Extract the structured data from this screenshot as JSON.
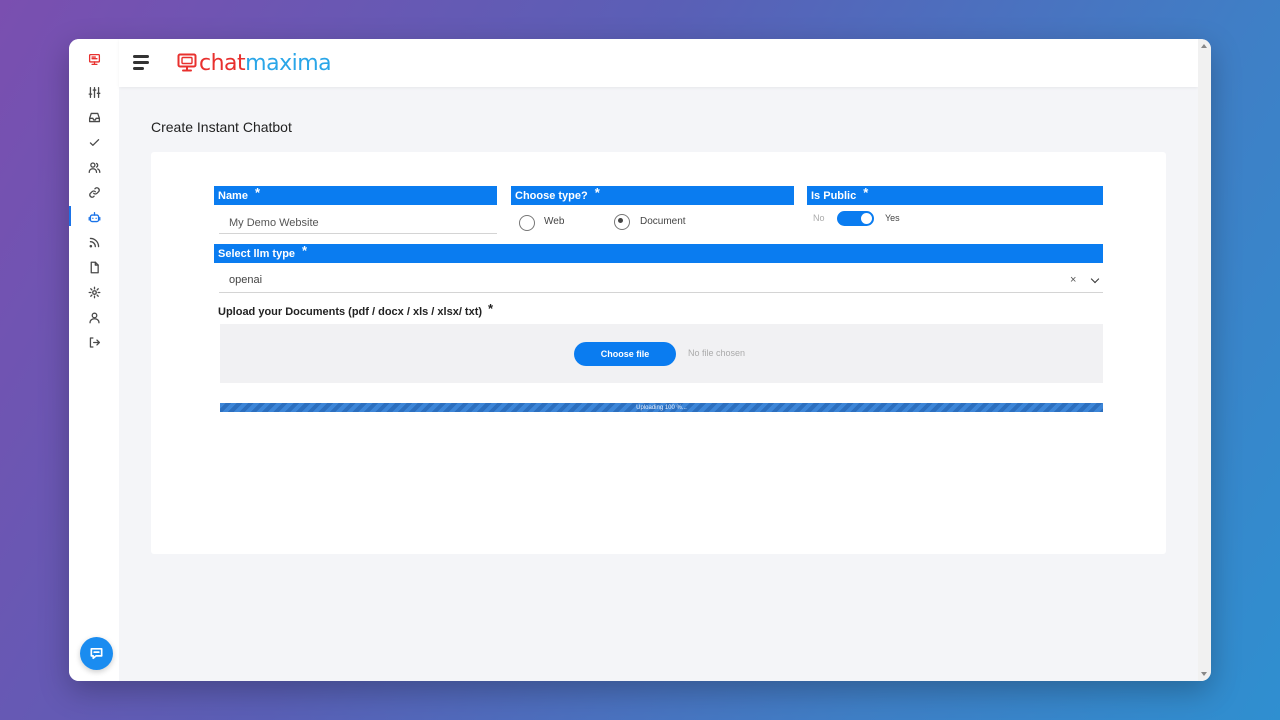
{
  "brand": {
    "chat": "chat",
    "maxima": "maxima"
  },
  "sidebar": {
    "items": [
      {
        "icon": "monitor-logo-icon"
      },
      {
        "icon": "sliders-icon"
      },
      {
        "icon": "inbox-icon"
      },
      {
        "icon": "check-icon"
      },
      {
        "icon": "users-icon"
      },
      {
        "icon": "link-icon"
      },
      {
        "icon": "bot-icon",
        "active": true
      },
      {
        "icon": "rss-icon"
      },
      {
        "icon": "file-icon"
      },
      {
        "icon": "gear-icon"
      },
      {
        "icon": "user-icon"
      },
      {
        "icon": "logout-icon"
      }
    ],
    "fab_icon": "chat-bubble-icon"
  },
  "page": {
    "title": "Create Instant Chatbot"
  },
  "form": {
    "name": {
      "label": "Name",
      "required": "*",
      "value": "My Demo Website"
    },
    "type": {
      "label": "Choose type?",
      "required": "*",
      "options": [
        "Web",
        "Document"
      ],
      "selected": "Document"
    },
    "public": {
      "label": "Is Public",
      "required": "*",
      "off_label": "No",
      "on_label": "Yes",
      "value": true
    },
    "llm": {
      "label": "Select llm type",
      "required": "*",
      "value": "openai",
      "clear": "×"
    },
    "upload": {
      "label": "Upload your Documents (pdf / docx / xls / xlsx/ txt)",
      "required": "*",
      "button": "Choose file",
      "no_file": "No file chosen",
      "progress_text": "Uploading 100 %...",
      "progress": 100
    }
  },
  "colors": {
    "accent": "#0a7cf0",
    "brand_red": "#e8302e",
    "brand_blue": "#2aa6e8"
  }
}
